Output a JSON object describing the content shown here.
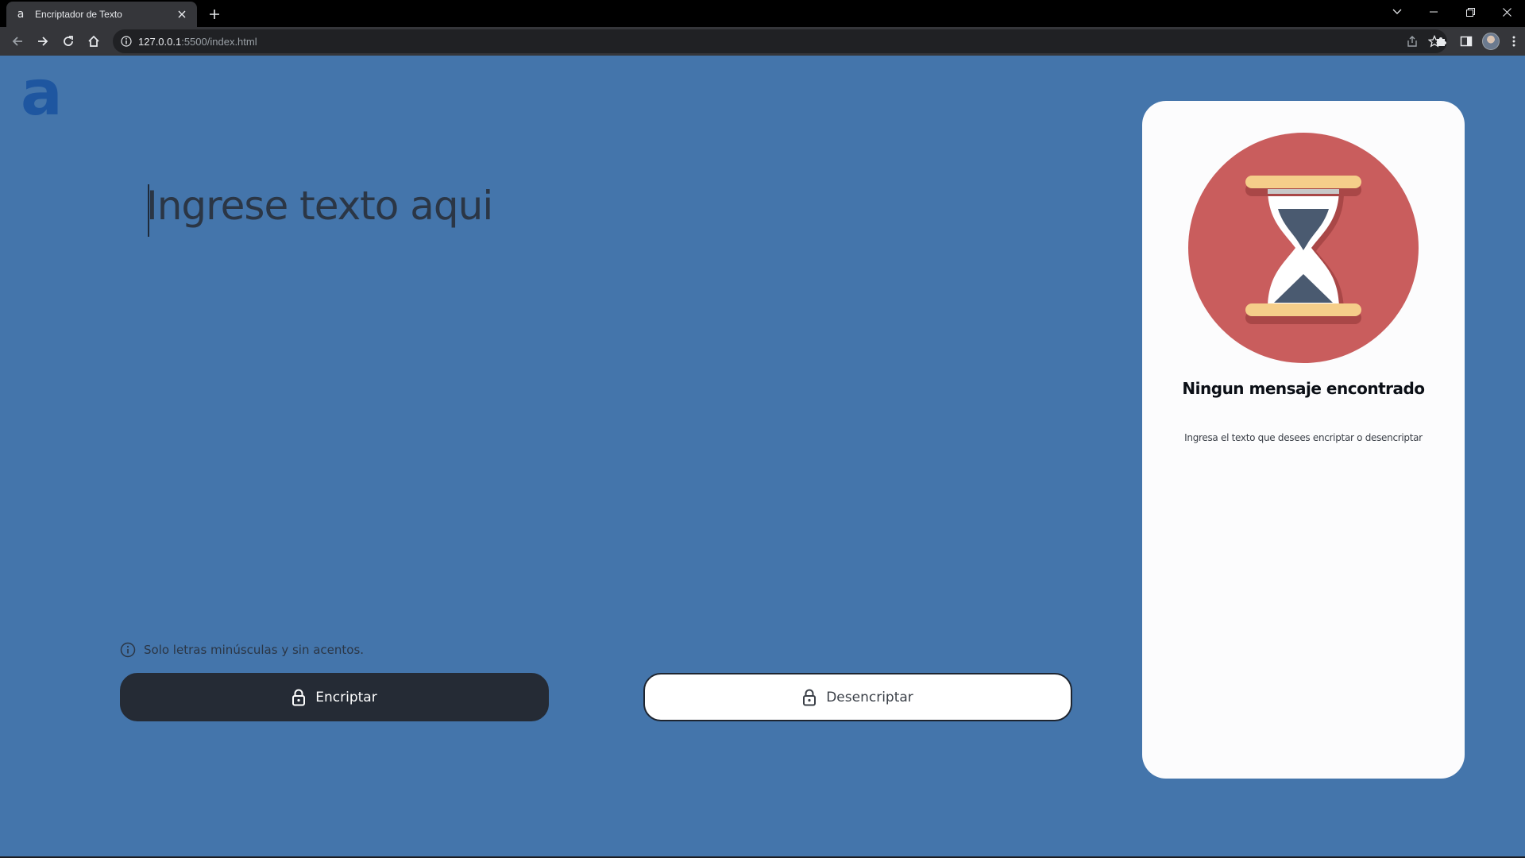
{
  "browser": {
    "tab_title": "Encriptador de Texto",
    "tab_favicon": "a",
    "url_host": "127.0.0.1",
    "url_rest": ":5500/index.html"
  },
  "app": {
    "logo": "a",
    "colors": {
      "page_background": "#4475ab",
      "logo": "#1e56a0",
      "primary_button": "#252b35",
      "panel": "#fcfcfd",
      "illustration_circle": "#c95d5d",
      "hourglass_caps": "#f5ce8a",
      "sand": "#4a5a70"
    }
  },
  "editor": {
    "placeholder": "Ingrese texto aqui",
    "hint": "Solo letras minúsculas y sin acentos."
  },
  "actions": {
    "encrypt_label": "Encriptar",
    "decrypt_label": "Desencriptar"
  },
  "result_panel": {
    "illustration": "hourglass-icon",
    "title": "Ningun mensaje encontrado",
    "subtitle": "Ingresa el texto que desees encriptar o desencriptar"
  }
}
